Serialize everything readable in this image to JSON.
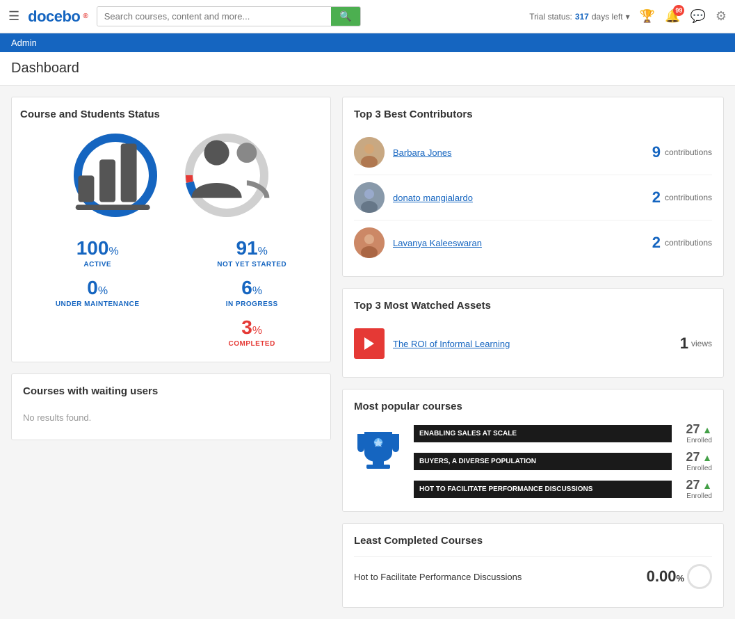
{
  "header": {
    "menu_icon": "☰",
    "logo_text": "docebo",
    "search_placeholder": "Search courses, content and more...",
    "search_icon": "🔍",
    "trial_label": "Trial status:",
    "trial_days": "317",
    "trial_suffix": "days left",
    "trophy_icon": "🏆",
    "bell_icon": "🔔",
    "bell_count": "99",
    "chat_icon": "💬",
    "gear_icon": "⚙"
  },
  "admin_bar": {
    "label": "Admin"
  },
  "page": {
    "title": "Dashboard"
  },
  "course_status": {
    "title": "Course and Students Status",
    "active_pct": "100",
    "active_label": "ACTIVE",
    "under_maintenance_pct": "0",
    "under_maintenance_label": "UNDER MAINTENANCE",
    "not_yet_started_pct": "91",
    "not_yet_started_label": "NOT YET STARTED",
    "in_progress_pct": "6",
    "in_progress_label": "IN PROGRESS",
    "completed_pct": "3",
    "completed_label": "COMPLETED",
    "unit": "%"
  },
  "waiting_users": {
    "title": "Courses with waiting users",
    "no_results": "No results found."
  },
  "contributors": {
    "title": "Top 3 Best Contributors",
    "items": [
      {
        "name": "Barbara Jones",
        "count": "9",
        "label": "contributions"
      },
      {
        "name": "donato mangialardo",
        "count": "2",
        "label": "contributions"
      },
      {
        "name": "Lavanya Kaleeswaran",
        "count": "2",
        "label": "contributions"
      }
    ]
  },
  "watched_assets": {
    "title": "Top 3 Most Watched Assets",
    "items": [
      {
        "title": "The ROI of Informal Learning",
        "views": "1",
        "label": "views"
      }
    ]
  },
  "popular_courses": {
    "title": "Most popular courses",
    "items": [
      {
        "title": "ENABLING SALES AT SCALE",
        "count": "27",
        "label": "Enrolled"
      },
      {
        "title": "BUYERS, A DIVERSE POPULATION",
        "count": "27",
        "label": "Enrolled"
      },
      {
        "title": "HOT TO FACILITATE PERFORMANCE DISCUSSIONS",
        "count": "27",
        "label": "Enrolled"
      }
    ]
  },
  "least_completed": {
    "title": "Least Completed Courses",
    "items": [
      {
        "title": "Hot to Facilitate Performance Discussions",
        "pct": "0.00",
        "unit": "%%"
      }
    ]
  }
}
